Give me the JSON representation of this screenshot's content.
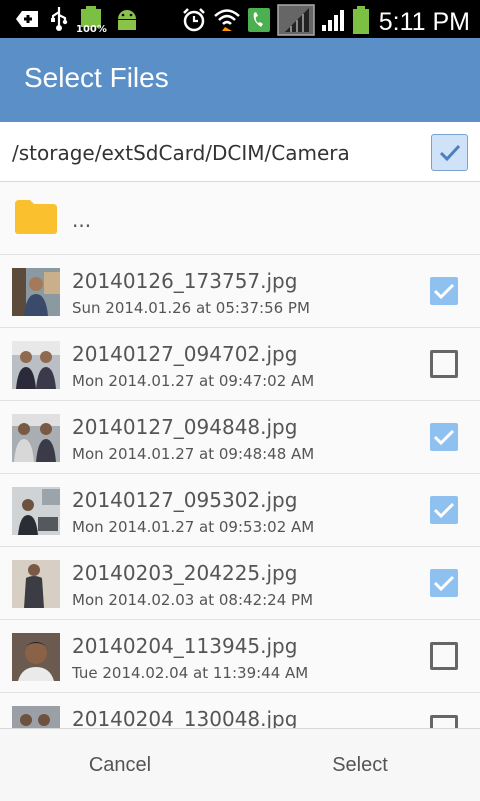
{
  "status_bar": {
    "battery_text": "100%",
    "time": "5:11 PM",
    "icons": [
      "usb-plus-icon",
      "usb-icon",
      "battery-full-icon",
      "android-icon",
      "alarm-icon",
      "wifi-icon",
      "phone-call-icon",
      "signal-icon",
      "battery-icon"
    ]
  },
  "app_bar": {
    "title": "Select Files"
  },
  "path_bar": {
    "path": "/storage/extSdCard/DCIM/Camera",
    "select_all_checked": true
  },
  "folder_up": {
    "label": "..."
  },
  "files": [
    {
      "name": "20140126_173757.jpg",
      "date": "Sun 2014.01.26 at 05:37:56 PM",
      "checked": true
    },
    {
      "name": "20140127_094702.jpg",
      "date": "Mon 2014.01.27 at 09:47:02 AM",
      "checked": false
    },
    {
      "name": "20140127_094848.jpg",
      "date": "Mon 2014.01.27 at 09:48:48 AM",
      "checked": true
    },
    {
      "name": "20140127_095302.jpg",
      "date": "Mon 2014.01.27 at 09:53:02 AM",
      "checked": true
    },
    {
      "name": "20140203_204225.jpg",
      "date": "Mon 2014.02.03 at 08:42:24 PM",
      "checked": true
    },
    {
      "name": "20140204_113945.jpg",
      "date": "Tue 2014.02.04 at 11:39:44 AM",
      "checked": false
    },
    {
      "name": "20140204_130048.jpg",
      "date": "",
      "checked": false
    }
  ],
  "buttons": {
    "cancel": "Cancel",
    "select": "Select"
  },
  "colors": {
    "app_bar": "#5b8fc7",
    "checkbox_on": "#8ec1f0",
    "folder": "#fbc02d"
  }
}
